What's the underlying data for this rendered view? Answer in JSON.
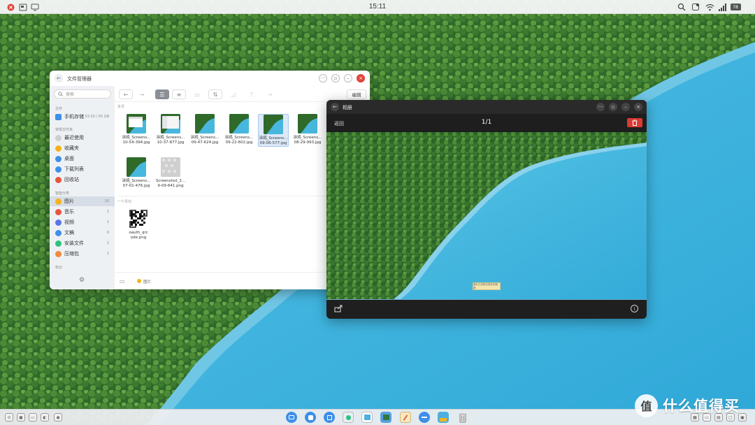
{
  "topbar": {
    "clock": "15:11",
    "battery": "78",
    "left_icons": [
      "app-close-icon",
      "screenshot-icon",
      "display-icon"
    ],
    "right_icons": [
      "search-icon",
      "notification-icon",
      "wifi-icon",
      "signal-icon",
      "battery-icon"
    ]
  },
  "file_manager": {
    "title": "文件管理器",
    "search_placeholder": "搜索",
    "edit_label": "编辑",
    "sidebar": {
      "section_files": "文件",
      "storage": {
        "label": "手机存储",
        "value": "53.50 / 55 GB"
      },
      "section_common": "常规文件夹",
      "common": [
        {
          "label": "最近使用",
          "icon": "clock-icon",
          "color": "#cfcfcf"
        },
        {
          "label": "收藏夹",
          "icon": "star-icon",
          "color": "#f5b21a"
        },
        {
          "label": "桌面",
          "icon": "desktop-icon",
          "color": "#3d8fe8"
        },
        {
          "label": "下载列表",
          "icon": "download-icon",
          "color": "#3d8fe8"
        },
        {
          "label": "回收站",
          "icon": "trash-icon",
          "color": "#e8553d"
        }
      ],
      "section_types": "智能分类",
      "types": [
        {
          "label": "图片",
          "count": "10",
          "icon": "image-icon",
          "color": "#f5b21a",
          "active": true
        },
        {
          "label": "音乐",
          "count": "1",
          "icon": "music-icon",
          "color": "#e8553d"
        },
        {
          "label": "视频",
          "count": "1",
          "icon": "video-icon",
          "color": "#5a76e8"
        },
        {
          "label": "文稿",
          "count": "6",
          "icon": "document-icon",
          "color": "#3d8fe8"
        },
        {
          "label": "安装文件",
          "count": "2",
          "icon": "package-icon",
          "color": "#2ec27e"
        },
        {
          "label": "压缩包",
          "count": "1",
          "icon": "archive-icon",
          "color": "#f08a3d"
        }
      ],
      "section_tags": "标记"
    },
    "group_this_month": "本月",
    "group_earlier": "一个月内",
    "files_row1": [
      {
        "name": "涂鸦_Screens...",
        "sub": "10-54-394.jpg",
        "kind": "calendar"
      },
      {
        "name": "涂鸦_Screens...",
        "sub": "10-37-877.jpg",
        "kind": "window"
      },
      {
        "name": "涂鸦_Screens...",
        "sub": "09-47-624.jpg",
        "kind": "forest"
      },
      {
        "name": "涂鸦_Screens...",
        "sub": "09-22-602.jpg",
        "kind": "forest"
      },
      {
        "name": "涂鸦_Screens...",
        "sub": "09-06-577.jpg",
        "kind": "forest",
        "selected": true
      },
      {
        "name": "涂鸦_Screens...",
        "sub": "08-29-993.jpg",
        "kind": "forest"
      }
    ],
    "files_row2": [
      {
        "name": "涂鸦_Screens...",
        "sub": "07-01-476.jpg",
        "kind": "forest"
      },
      {
        "name": "Screenshot_2...",
        "sub": "9-09-641.png",
        "kind": "gray"
      }
    ],
    "files_row3": [
      {
        "name": "oauth_qrc",
        "sub": "ode.png",
        "kind": "qr"
      }
    ],
    "footer_path": "图片"
  },
  "photo_viewer": {
    "title": "相册",
    "back_label": "返回",
    "counter": "1/1",
    "toast": "图片已涂鸦已保存到相册"
  },
  "watermark": {
    "text": "什么值得买",
    "logo": "值"
  },
  "dock": {
    "apps": [
      "finder-icon",
      "browser-icon",
      "grid-icon",
      "photos-icon",
      "gallery-icon",
      "notes-icon",
      "settings-icon",
      "wallpaper-icon",
      "trash-icon"
    ]
  }
}
